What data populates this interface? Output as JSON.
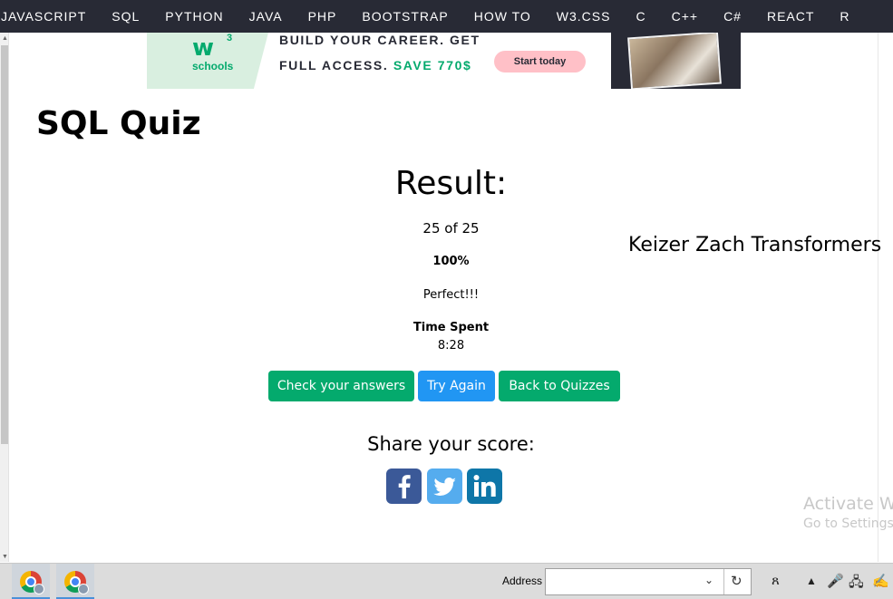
{
  "nav": {
    "items": [
      "JAVASCRIPT",
      "SQL",
      "PYTHON",
      "JAVA",
      "PHP",
      "BOOTSTRAP",
      "HOW TO",
      "W3.CSS",
      "C",
      "C++",
      "C#",
      "REACT",
      "R"
    ]
  },
  "ad": {
    "logo_text": "w",
    "logo_sup": "3",
    "logo_sub": "schools",
    "line1": "BUILD YOUR CAREER. GET",
    "line2_a": "FULL ACCESS.",
    "line2_b": "SAVE 770$",
    "cta": "Start today"
  },
  "page": {
    "title": "SQL Quiz"
  },
  "result": {
    "heading": "Result:",
    "score": "25 of 25",
    "percent": "100%",
    "message": "Perfect!!!",
    "time_label": "Time Spent",
    "time_value": "8:28"
  },
  "user": {
    "name": "Keizer Zach Transformers"
  },
  "buttons": {
    "check": "Check your answers",
    "try": "Try Again",
    "back": "Back to Quizzes"
  },
  "share": {
    "label": "Share your score:",
    "networks": [
      "facebook-icon",
      "twitter-icon",
      "linkedin-icon"
    ]
  },
  "watermark": {
    "line1": "Activate Wi",
    "line2": "Go to Settings t"
  },
  "taskbar": {
    "address_label": "Address",
    "address_value": ""
  },
  "colors": {
    "nav_bg": "#282a35",
    "accent_green": "#04aa6d",
    "accent_blue": "#2196f3"
  }
}
